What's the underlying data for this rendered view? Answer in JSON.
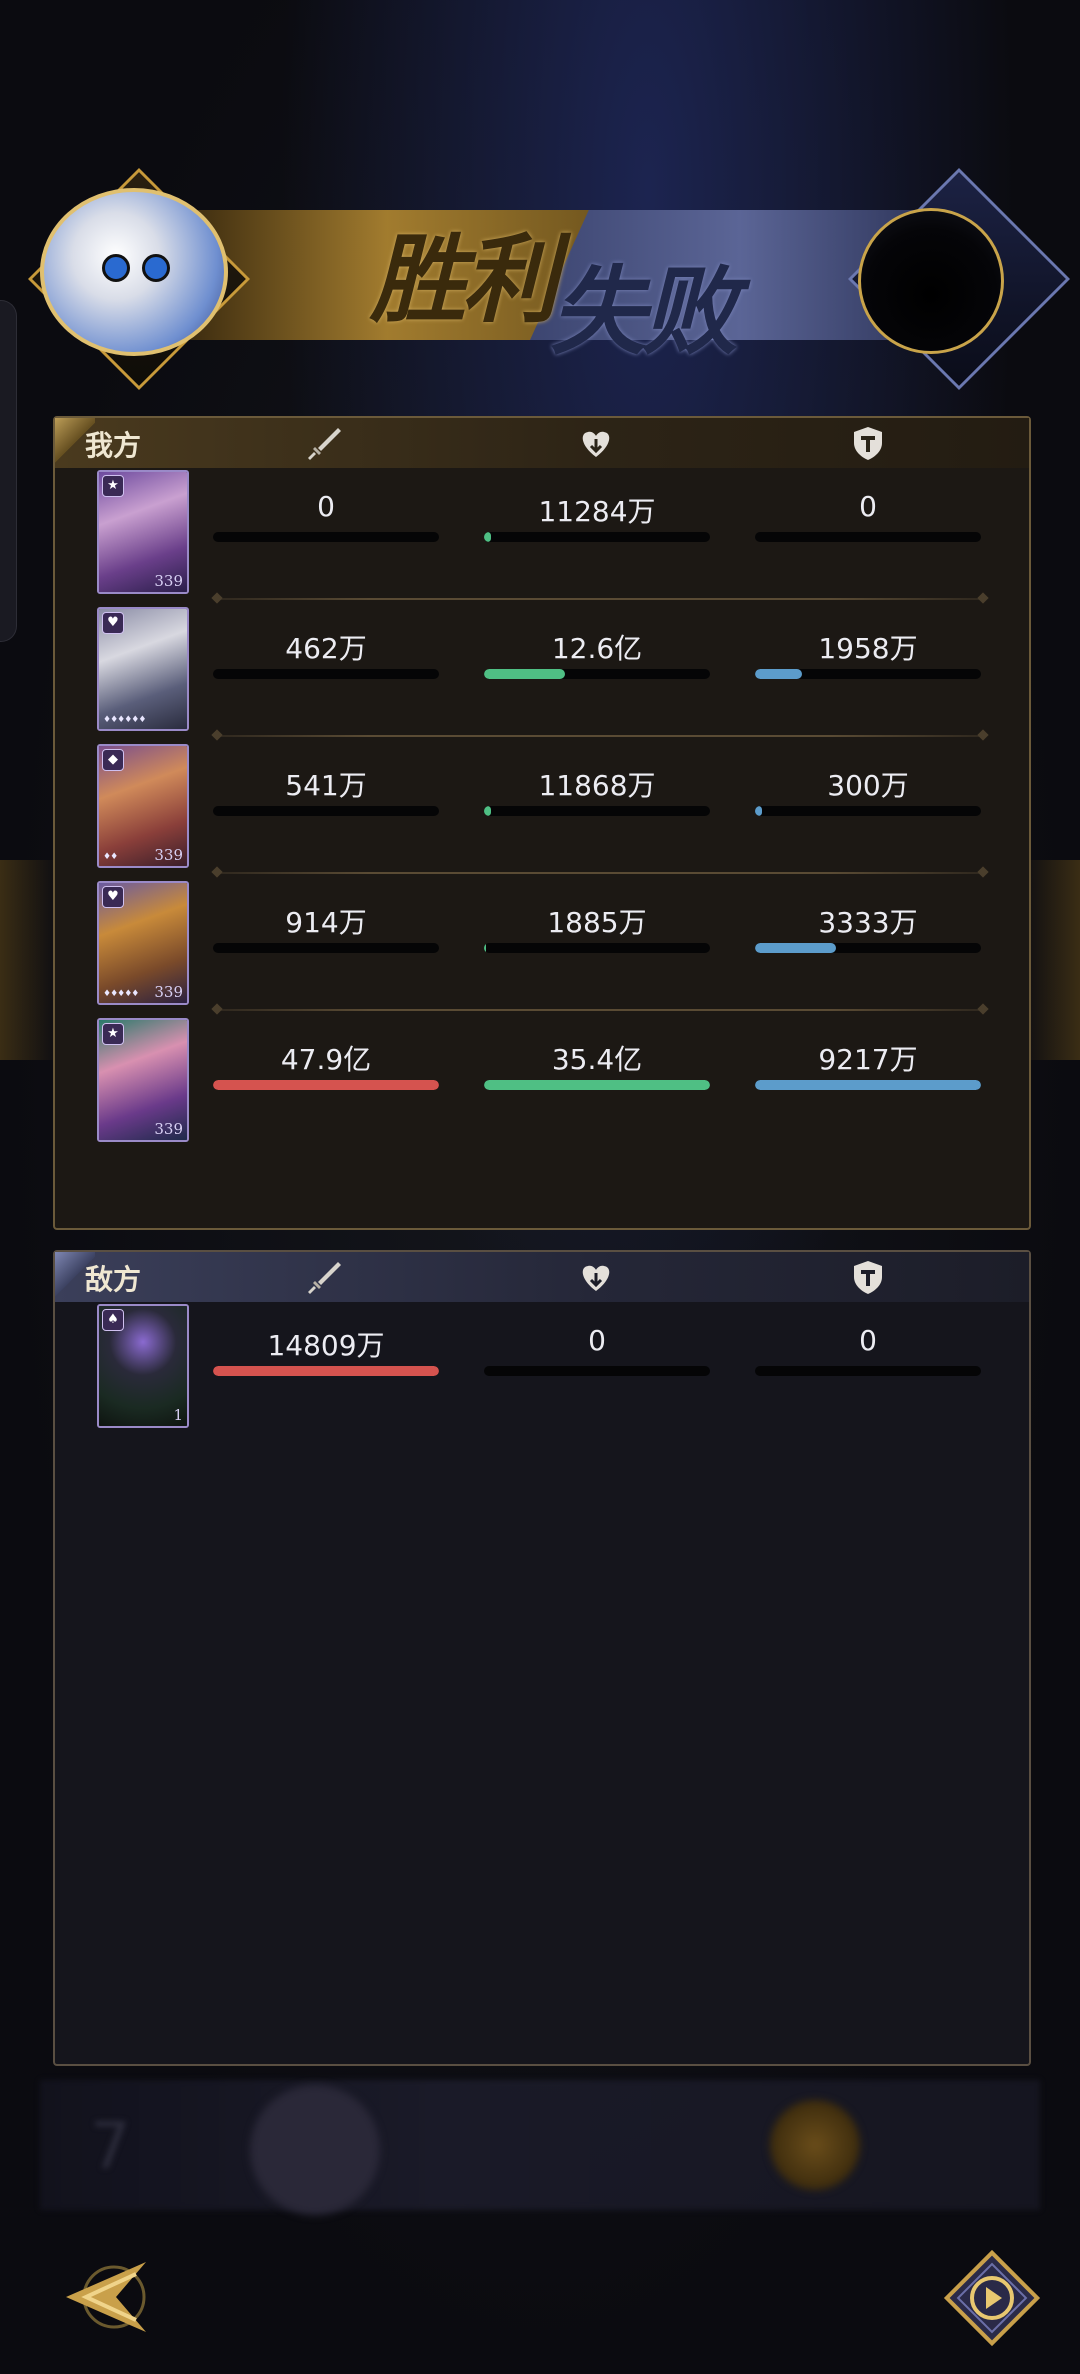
{
  "banner": {
    "victory_label": "胜利",
    "defeat_label": "失败"
  },
  "our_team": {
    "title": "我方",
    "header_icons": [
      "sword-icon",
      "heart-icon",
      "shield-icon"
    ],
    "heroes": [
      {
        "damage": "0",
        "healing": "11284万",
        "defense": "0",
        "damage_frac": 0.0,
        "healing_frac": 0.03,
        "defense_frac": 0.0,
        "level": "339",
        "badge": "★",
        "stars": ""
      },
      {
        "damage": "462万",
        "healing": "12.6亿",
        "defense": "1958万",
        "damage_frac": 0.0,
        "healing_frac": 0.36,
        "defense_frac": 0.21,
        "level": "",
        "badge": "♥",
        "stars": "♦♦♦♦♦♦"
      },
      {
        "damage": "541万",
        "healing": "11868万",
        "defense": "300万",
        "damage_frac": 0.0,
        "healing_frac": 0.03,
        "defense_frac": 0.03,
        "level": "339",
        "badge": "◆",
        "stars": "♦♦"
      },
      {
        "damage": "914万",
        "healing": "1885万",
        "defense": "3333万",
        "damage_frac": 0.0,
        "healing_frac": 0.01,
        "defense_frac": 0.36,
        "level": "339",
        "badge": "♥",
        "stars": "♦♦♦♦♦"
      },
      {
        "damage": "47.9亿",
        "healing": "35.4亿",
        "defense": "9217万",
        "damage_frac": 1.0,
        "healing_frac": 1.0,
        "defense_frac": 1.0,
        "level": "339",
        "badge": "★",
        "stars": ""
      }
    ]
  },
  "enemy_team": {
    "title": "敌方",
    "header_icons": [
      "sword-icon",
      "heart-icon",
      "shield-icon"
    ],
    "heroes": [
      {
        "damage": "14809万",
        "healing": "0",
        "defense": "0",
        "damage_frac": 1.0,
        "healing_frac": 0.0,
        "defense_frac": 0.0,
        "level": "1",
        "badge": "♠",
        "stars": ""
      }
    ]
  },
  "colors": {
    "damage": "#d5534f",
    "healing": "#4fbf84",
    "defense": "#5c9ccb"
  },
  "controls": {
    "back_icon": "back-arrow-icon",
    "replay_icon": "replay-play-icon"
  }
}
